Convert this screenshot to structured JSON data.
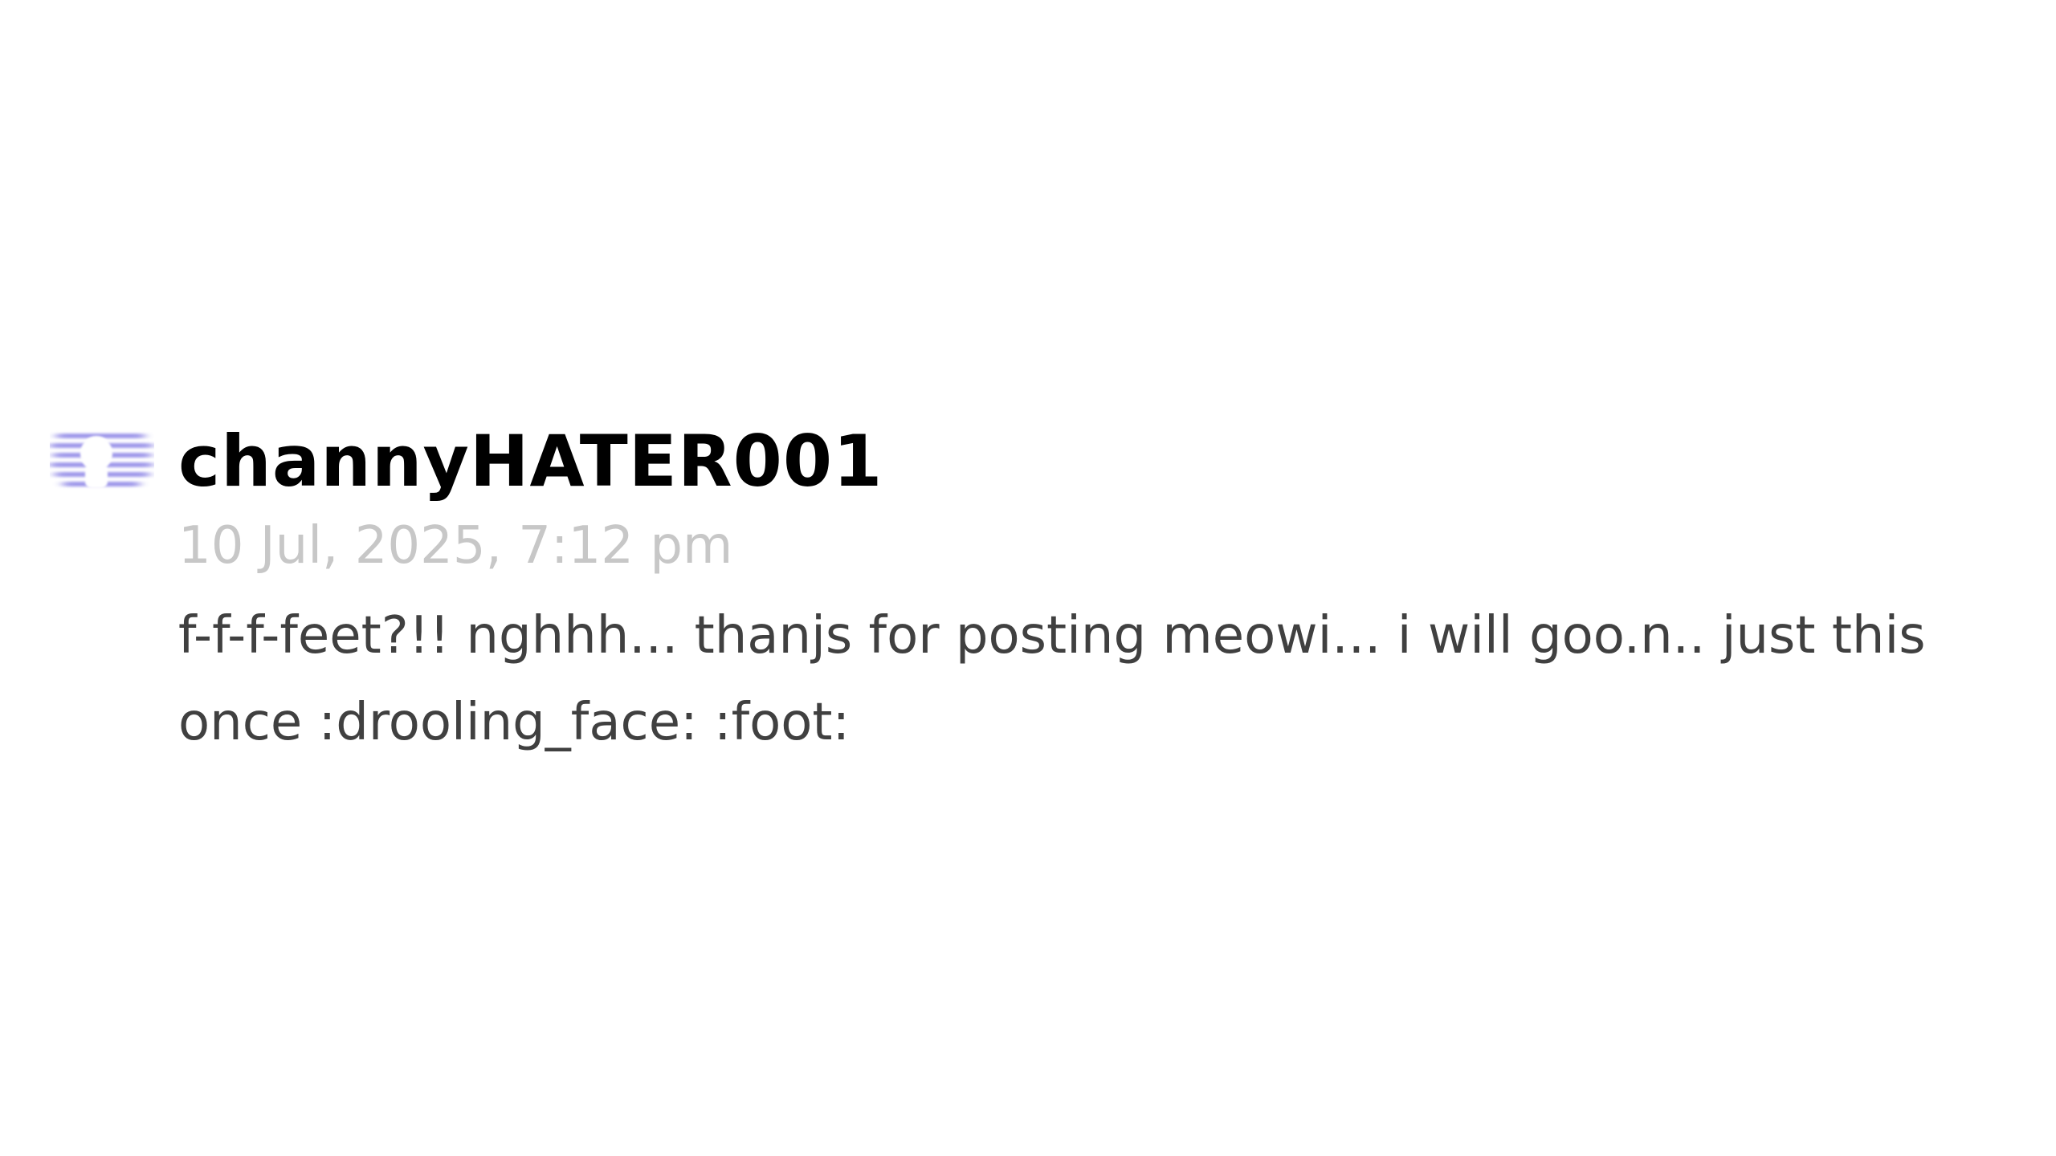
{
  "comment": {
    "author": "channyHATER001",
    "timestamp": "10 Jul, 2025, 7:12 pm",
    "text": "f-f-f-feet?!! nghhh... thanjs for posting meowi... i will goo.n.. just this once :drooling_face: :foot:",
    "avatar_icon": "user-avatar-icon",
    "avatar_color": "#8e86e6"
  },
  "colors": {
    "background": "#ffffff",
    "username": "#000000",
    "timestamp": "#c7c7c7",
    "body": "#404040"
  }
}
